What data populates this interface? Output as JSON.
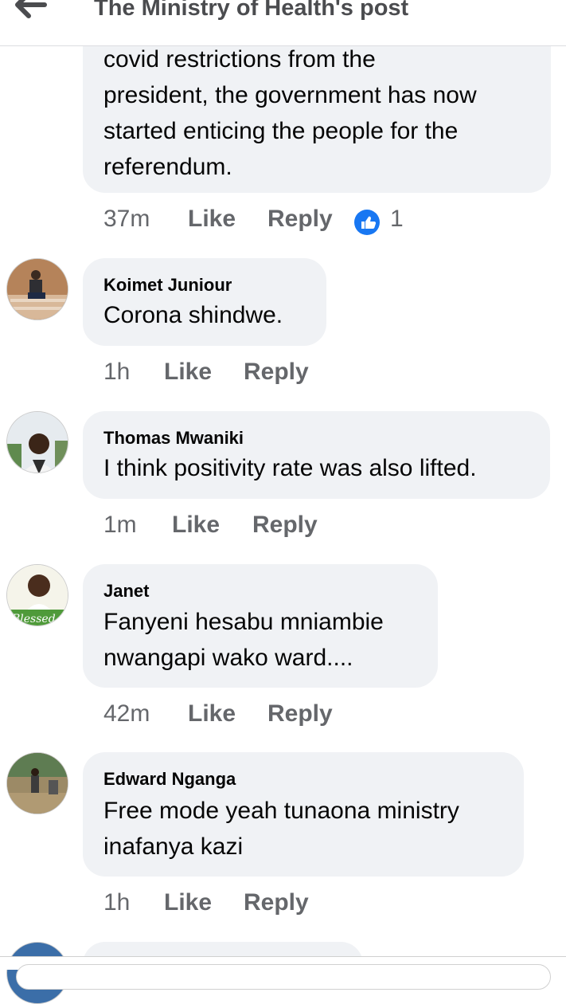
{
  "header": {
    "title": "The Ministry of Health's post"
  },
  "first_comment": {
    "text": "covid restrictions from the\npresident, the government has now\nstarted enticing the people for the\nreferendum.",
    "time": "37m",
    "like": "Like",
    "reply": "Reply",
    "reaction_count": "1"
  },
  "comments": [
    {
      "name": "Koimet Juniour",
      "text": "Corona shindwe.",
      "time": "1h",
      "like": "Like",
      "reply": "Reply"
    },
    {
      "name": "Thomas Mwaniki",
      "text": "I think positivity rate was also lifted.",
      "time": "1m",
      "like": "Like",
      "reply": "Reply"
    },
    {
      "name": "Janet",
      "text": "Fanyeni hesabu mniambie\nnwangapi wako ward....",
      "time": "42m",
      "like": "Like",
      "reply": "Reply",
      "avatar_caption": "Blessed"
    },
    {
      "name": "Edward Nganga",
      "text": "Free mode yeah tunaona ministry\ninafanya kazi",
      "time": "1h",
      "like": "Like",
      "reply": "Reply"
    }
  ],
  "colors": {
    "bubble": "#f0f2f5",
    "meta": "#65676b",
    "like_blue": "#1877f2"
  }
}
